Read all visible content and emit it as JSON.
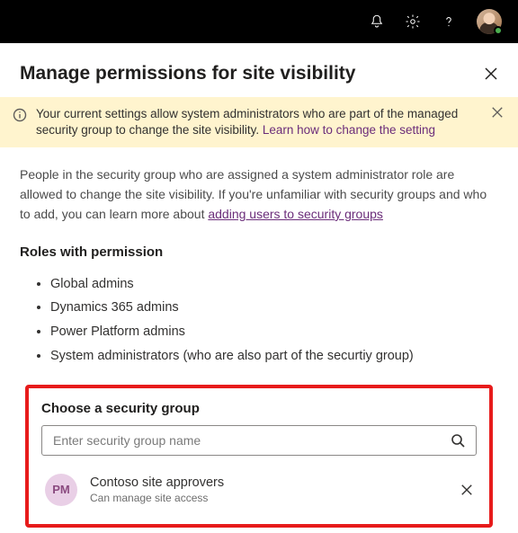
{
  "header": {
    "title": "Manage permissions for site visibility"
  },
  "banner": {
    "text": "Your current settings allow system administrators who are part of the managed security group to change the site visibility. ",
    "link_text": "Learn how to change the setting"
  },
  "intro": {
    "text_before": "People in the security group who are assigned a system administrator role are allowed to change the site visibility. If you're unfamiliar with security groups and who to add, you can learn more about ",
    "link_text": "adding users to security groups"
  },
  "roles": {
    "title": "Roles with permission",
    "items": [
      "Global admins",
      "Dynamics 365 admins",
      "Power Platform admins",
      "System administrators (who are also part of the securtiy group)"
    ]
  },
  "choose": {
    "title": "Choose a security group",
    "placeholder": "Enter security group name"
  },
  "selected_group": {
    "initials": "PM",
    "name": "Contoso site approvers",
    "subtitle": "Can manage site access"
  }
}
